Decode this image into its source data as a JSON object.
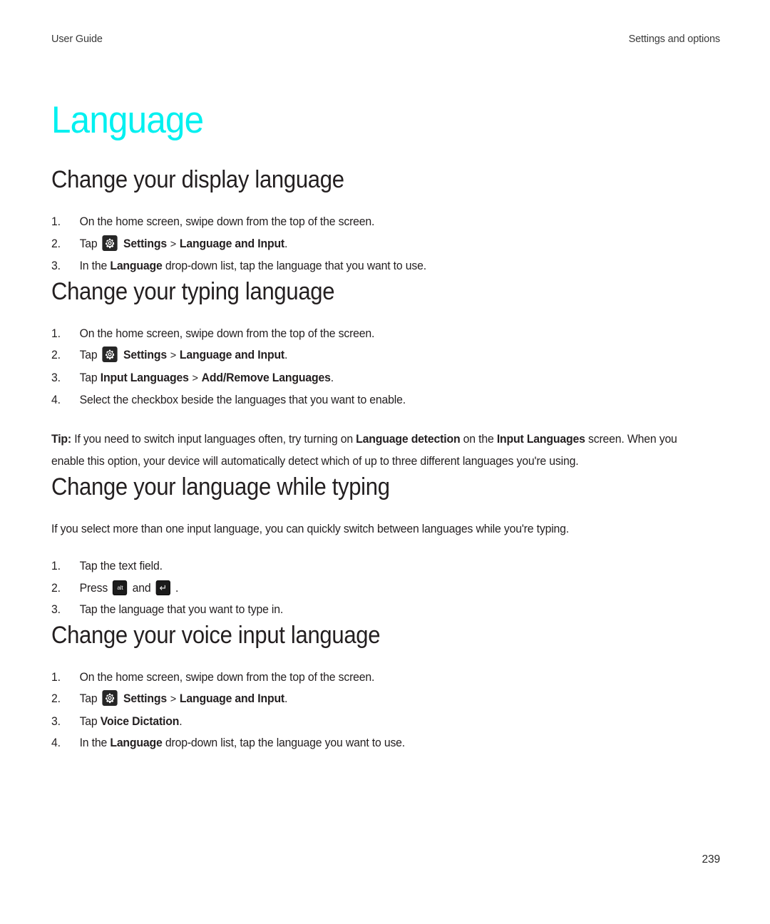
{
  "header": {
    "left": "User Guide",
    "right": "Settings and options"
  },
  "chapter": {
    "title": "Language",
    "color": "#00f0f0"
  },
  "icons": {
    "settings_gear": "gear-icon",
    "alt_key": "alt",
    "enter_key": "↵"
  },
  "sections": [
    {
      "heading": "Change your display language",
      "steps": [
        {
          "pre": "On the home screen, swipe down from the top of the screen."
        },
        {
          "pre": "Tap ",
          "icon": "gear",
          "b1": "Settings",
          "sep": ">",
          "b2": "Language and Input",
          "post": "."
        },
        {
          "pre": "In the ",
          "b1": "Language",
          "post": " drop-down list, tap the language that you want to use."
        }
      ]
    },
    {
      "heading": "Change your typing language",
      "steps": [
        {
          "pre": "On the home screen, swipe down from the top of the screen."
        },
        {
          "pre": "Tap ",
          "icon": "gear",
          "b1": "Settings",
          "sep": ">",
          "b2": "Language and Input",
          "post": "."
        },
        {
          "pre": "Tap ",
          "b1": "Input Languages",
          "sep": ">",
          "b2": "Add/Remove Languages",
          "post": "."
        },
        {
          "pre": "Select the checkbox beside the languages that you want to enable."
        }
      ],
      "tip": {
        "label": "Tip:",
        "t1": " If you need to switch input languages often, try turning on ",
        "b1": "Language detection",
        "t2": " on the ",
        "b2": "Input Languages",
        "t3": " screen. When you enable this option, your device will automatically detect which of up to three different languages you're using."
      }
    },
    {
      "heading": "Change your language while typing",
      "intro": "If you select more than one input language, you can quickly switch between languages while you're typing.",
      "steps": [
        {
          "pre": "Tap the text field."
        },
        {
          "pre": "Press ",
          "key1": "alt",
          "mid": " and ",
          "key2": "↵",
          "post": " ."
        },
        {
          "pre": "Tap the language that you want to type in."
        }
      ]
    },
    {
      "heading": "Change your voice input language",
      "steps": [
        {
          "pre": "On the home screen, swipe down from the top of the screen."
        },
        {
          "pre": "Tap ",
          "icon": "gear",
          "b1": "Settings",
          "sep": ">",
          "b2": "Language and Input",
          "post": "."
        },
        {
          "pre": "Tap ",
          "b1": "Voice Dictation",
          "post": "."
        },
        {
          "pre": "In the ",
          "b1": "Language",
          "post": " drop-down list, tap the language you want to use."
        }
      ]
    }
  ],
  "folio": "239"
}
